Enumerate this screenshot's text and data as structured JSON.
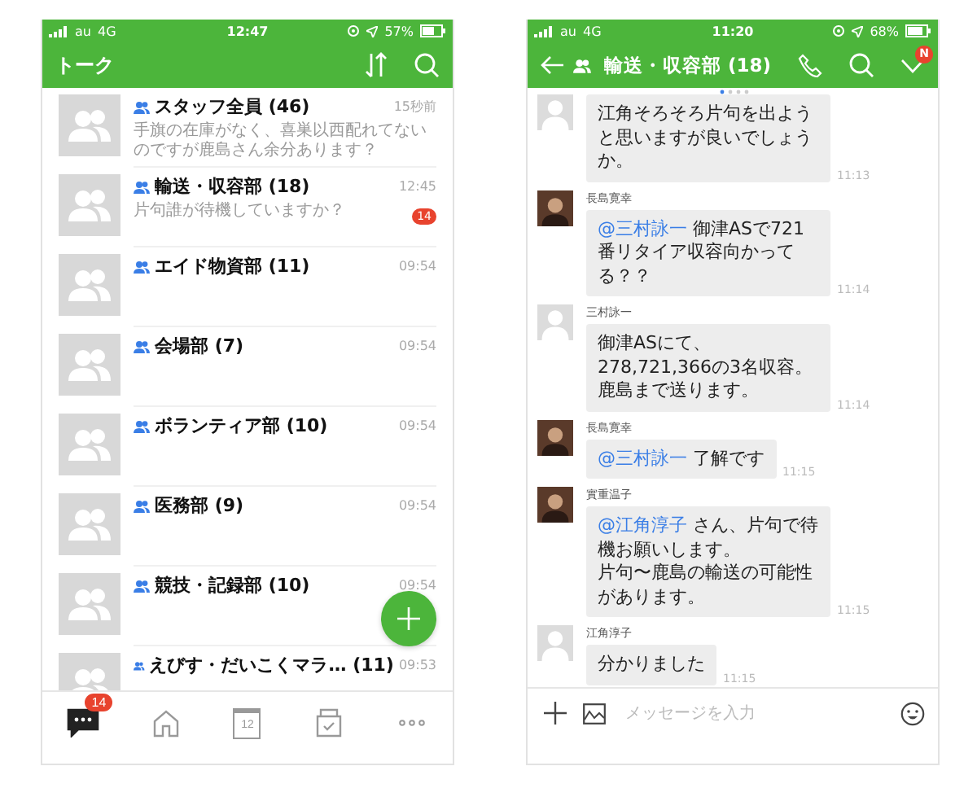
{
  "talk_list_screen": {
    "status_bar": {
      "carrier": "au",
      "network": "4G",
      "time": "12:47",
      "battery": "57%"
    },
    "header": {
      "title": "トーク"
    },
    "chats": [
      {
        "name": "スタッフ全員 (46)",
        "preview": "手旗の在庫がなく、喜巣以西配れてないのですが鹿島さん余分あります？",
        "time": "15秒前"
      },
      {
        "name": "輸送・収容部 (18)",
        "preview": "片句誰が待機していますか？",
        "time": "12:45",
        "unread": "14"
      },
      {
        "name": "エイド物資部 (11)",
        "time": "09:54"
      },
      {
        "name": "会場部 (7)",
        "time": "09:54"
      },
      {
        "name": "ボランティア部 (10)",
        "time": "09:54"
      },
      {
        "name": "医務部 (9)",
        "time": "09:54"
      },
      {
        "name": "競技・記録部 (10)",
        "time": "09:54"
      },
      {
        "name": "えびす・だいこくマラ…  (11)",
        "time": "09:53"
      }
    ],
    "tab_bar": [
      {
        "kind": "chats",
        "selected": true,
        "badge": "14"
      },
      {
        "kind": "home",
        "selected": false
      },
      {
        "kind": "calendar",
        "selected": false,
        "label": "12"
      },
      {
        "kind": "tasks",
        "selected": false
      },
      {
        "kind": "more",
        "selected": false
      }
    ]
  },
  "chat_screen": {
    "status_bar": {
      "carrier": "au",
      "network": "4G",
      "time": "11:20",
      "battery": "68%"
    },
    "header": {
      "title": "輸送・収容部 (18)",
      "badge": "N"
    },
    "messages": [
      {
        "avatar_photo": false,
        "text": "江角そろそろ片句を出ようと思いますが良いでしょうか。",
        "time": "11:13"
      },
      {
        "sender": "長島寛幸",
        "avatar_photo": true,
        "mention": "@三村詠一",
        "text": "御津ASで721番リタイア収容向かってる？？",
        "time": "11:14"
      },
      {
        "sender": "三村詠一",
        "avatar_photo": false,
        "text": "御津ASにて、278,721,366の3名収容。鹿島まで送ります。",
        "time": "11:14"
      },
      {
        "sender": "長島寛幸",
        "avatar_photo": true,
        "mention": "@三村詠一",
        "text": "了解です",
        "time": "11:15"
      },
      {
        "sender": "實重温子",
        "avatar_photo": true,
        "mention": "@江角淳子",
        "text": "さん、片句で待機お願いします。",
        "text_2": "片句〜鹿島の輸送の可能性があります。",
        "time": "11:15"
      },
      {
        "sender": "江角淳子",
        "avatar_photo": false,
        "text": "分かりました",
        "time": "11:15"
      }
    ],
    "input": {
      "placeholder": "メッセージを入力"
    }
  }
}
